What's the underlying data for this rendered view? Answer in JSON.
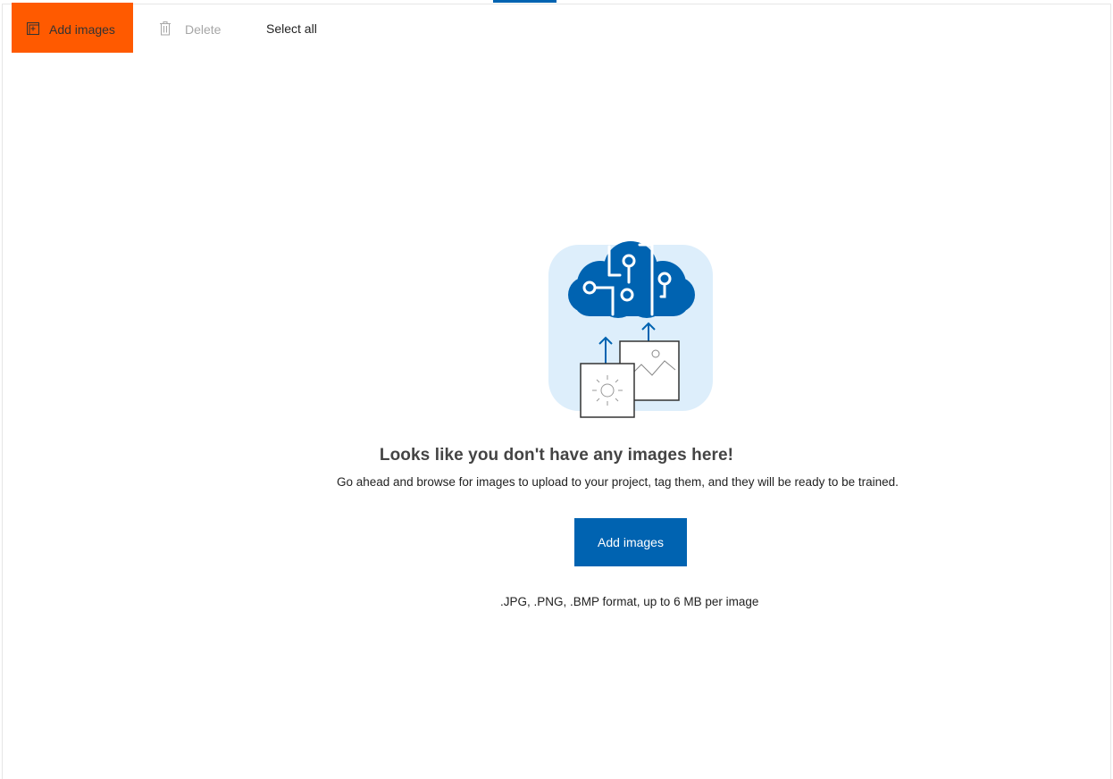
{
  "toolbar": {
    "add_label": "Add images",
    "delete_label": "Delete",
    "select_all_label": "Select all"
  },
  "empty_state": {
    "title": "Looks like you don't have any images here!",
    "description": "Go ahead and browse for images to upload to your project, tag them, and they will be ready to be trained.",
    "button_label": "Add images",
    "format_note": ".JPG, .PNG, .BMP format, up to 6 MB per image"
  },
  "colors": {
    "highlight": "#ff5a00",
    "accent": "#0063b1",
    "illustration_bg": "#ddeefb"
  },
  "icons": {
    "add": "add-image-icon",
    "delete": "trash-icon",
    "illustration": "cloud-brain-upload-illustration"
  }
}
